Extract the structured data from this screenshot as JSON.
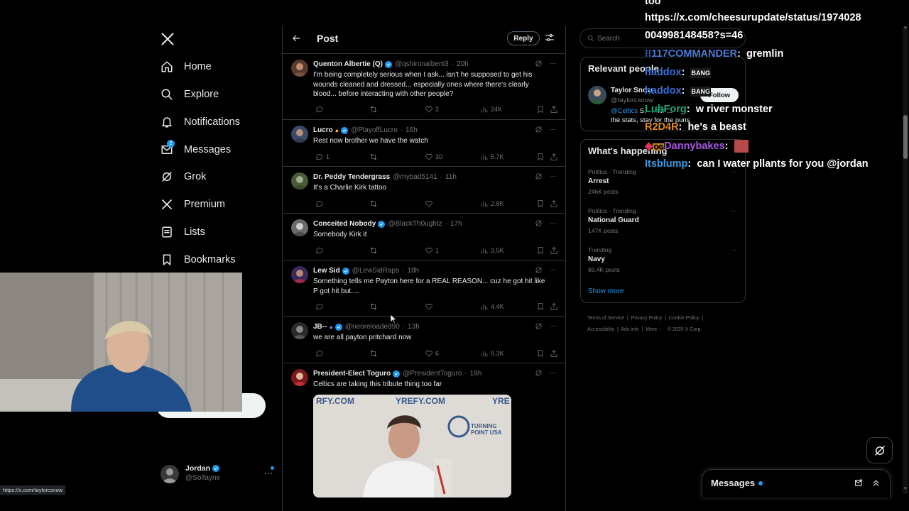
{
  "nav": {
    "items": [
      {
        "label": "Home",
        "icon": "home-icon"
      },
      {
        "label": "Explore",
        "icon": "search-icon"
      },
      {
        "label": "Notifications",
        "icon": "bell-icon"
      },
      {
        "label": "Messages",
        "icon": "mail-icon",
        "badge": "2"
      },
      {
        "label": "Grok",
        "icon": "grok-icon"
      },
      {
        "label": "Premium",
        "icon": "x-logo-icon"
      },
      {
        "label": "Lists",
        "icon": "list-icon"
      },
      {
        "label": "Bookmarks",
        "icon": "bookmark-icon"
      }
    ],
    "account": {
      "name": "Jordan",
      "handle": "@Solfayne"
    }
  },
  "status_url": "https://x.com/taylorcsnow",
  "header": {
    "title": "Post",
    "reply_label": "Reply"
  },
  "tweets": [
    {
      "name": "Quenton Albertie (Q)",
      "handle": "@qshironalberti3",
      "time": "20h",
      "text": "I'm being completely serious when I ask... isn't he supposed to get his wounds cleaned and dressed... especially ones where there's clearly blood... before interacting with other people?",
      "replies": "",
      "likes": "2",
      "views": "24K"
    },
    {
      "name": "Lucro",
      "handle": "@PlayoffLucro",
      "time": "16h",
      "text": "Rest now brother we have the watch",
      "replies": "1",
      "likes": "30",
      "views": "5.7K"
    },
    {
      "name": "Dr. Peddy Tendergrass",
      "handle": "@mybad5141",
      "time": "11h",
      "text": "It's a Charlie Kirk tattoo",
      "replies": "",
      "likes": "",
      "views": "2.8K"
    },
    {
      "name": "Conceited Nobody",
      "handle": "@BlackTh0ughtz",
      "time": "17h",
      "text": "Somebody Kirk it",
      "replies": "",
      "likes": "1",
      "views": "3.5K"
    },
    {
      "name": "Lew Sid",
      "handle": "@LewSidRaps",
      "time": "18h",
      "text": "Something tells me Payton here for a REAL REASON... cuz he got hit like P got hit but....",
      "replies": "",
      "likes": "",
      "views": "4.4K"
    },
    {
      "name": "JB--",
      "handle": "@neoreloaded90",
      "time": "13h",
      "text": "we are all payton pritchard now",
      "replies": "",
      "likes": "6",
      "views": "9.3K"
    },
    {
      "name": "President-Elect Toguro",
      "handle": "@PresidentToguro",
      "time": "19h",
      "text": "Celtics are taking this tribute thing too far",
      "replies": "",
      "likes": "",
      "views": ""
    }
  ],
  "media": {
    "banner_text_1": "YREFY.COM",
    "banner_text_2": "YRE",
    "logo_text": "TURNING POINT USA",
    "left_text": "RFY.COM"
  },
  "search": {
    "placeholder": "Search"
  },
  "relevant": {
    "title": "Relevant people",
    "name": "Taylor Snow",
    "handle": "@taylorcsnow",
    "bio_mention": "@Celtics",
    "bio_rest": "S...   ...ter ...",
    "bio_line2": "the stats, stay for the puns",
    "follow_label": "Follow"
  },
  "happening": {
    "title": "What's happening",
    "trends": [
      {
        "meta": "Politics · Trending",
        "name": "Arrest",
        "count": "246K posts"
      },
      {
        "meta": "Politics · Trending",
        "name": "National Guard",
        "count": "147K posts"
      },
      {
        "meta": "Trending",
        "name": "Navy",
        "count": "65.4K posts"
      }
    ],
    "show_more": "Show more"
  },
  "footer": {
    "links": [
      "Terms of Service",
      "Privacy Policy",
      "Cookie Policy",
      "Accessibility",
      "Ads info",
      "More ···"
    ],
    "copyright": "© 2025 X Corp."
  },
  "messages_drawer": {
    "label": "Messages"
  },
  "chat": [
    {
      "user": "",
      "text": "too",
      "color": "#ffffff"
    },
    {
      "user": "",
      "text": "https://x.com/cheesurupdate/status/1974028",
      "color": "#ffffff"
    },
    {
      "user": "",
      "text": "004998148458?s=46",
      "color": "#ffffff"
    },
    {
      "user": "117COMMANDER",
      "text": "gremlin",
      "color": "#4c7bd6"
    },
    {
      "user": "haddox",
      "text": "",
      "color": "#3b6ed8"
    },
    {
      "user": "haddox",
      "text": "",
      "color": "#3b6ed8"
    },
    {
      "user": "LuhForg",
      "text": "w river monster",
      "color": "#1aa77a"
    },
    {
      "user": "R2D4R",
      "text": "he's a beast",
      "color": "#e08a1e"
    },
    {
      "user": "Dannybakes",
      "text": "",
      "color": "#a65ae0"
    },
    {
      "user": "Itsblump",
      "text": "can I water pllants for you @jordan",
      "color": "#3b9ae0"
    }
  ],
  "chat_emote": "BANG",
  "colors": {
    "accent": "#1d9bf0",
    "background": "#000000",
    "border": "#2f3336",
    "muted": "#71767b"
  }
}
